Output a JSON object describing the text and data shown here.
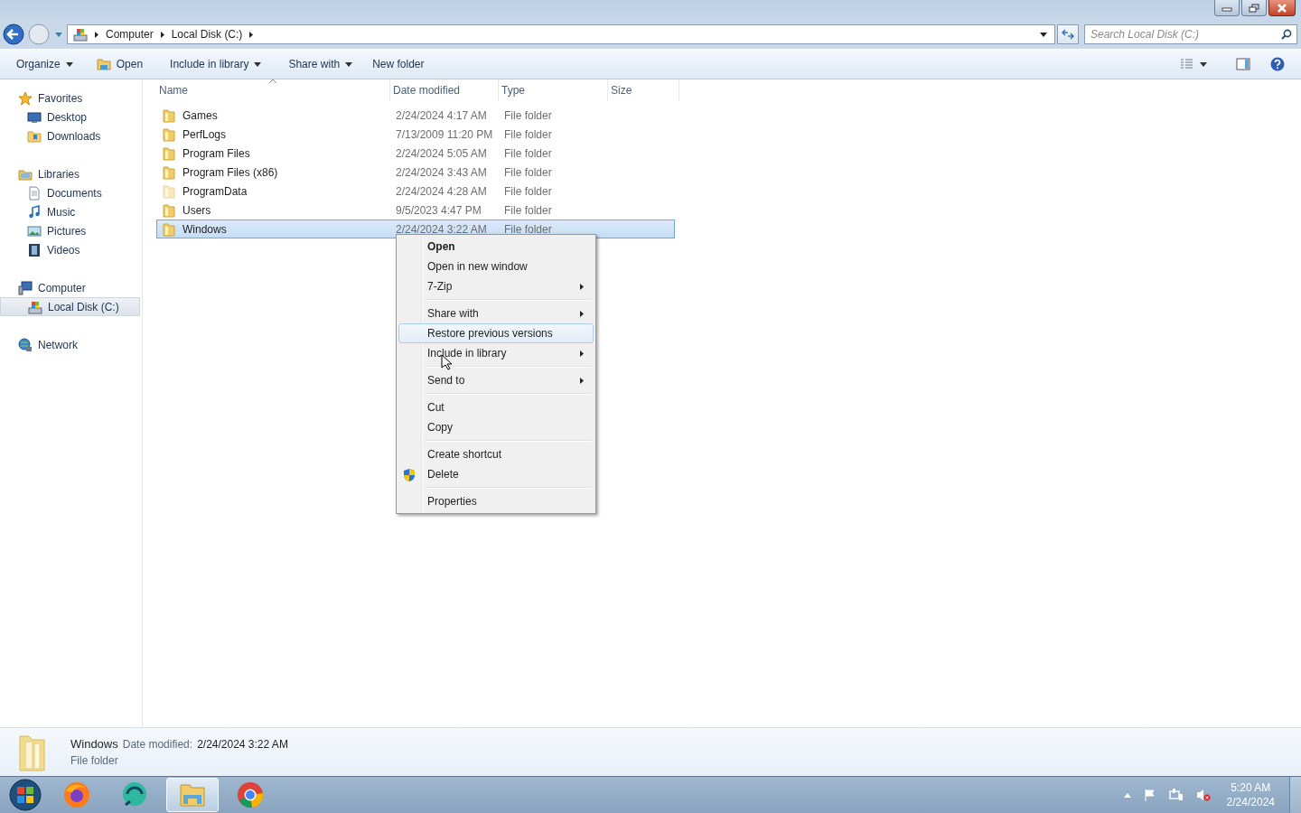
{
  "address_bar": {
    "crumbs": [
      "Computer",
      "Local Disk (C:)"
    ]
  },
  "search": {
    "placeholder": "Search Local Disk (C:)"
  },
  "toolbar": [
    {
      "label": "Organize",
      "kind": "menu"
    },
    {
      "label": "Open",
      "kind": "open"
    },
    {
      "label": "Include in library",
      "kind": "menu"
    },
    {
      "label": "Share with",
      "kind": "menu"
    },
    {
      "label": "New folder",
      "kind": "plain"
    }
  ],
  "sidebar": [
    {
      "label": "Favorites",
      "kind": "star",
      "selected": false,
      "children": [
        {
          "label": "Desktop",
          "kind": "desktop",
          "selected": false
        },
        {
          "label": "Downloads",
          "kind": "folder",
          "selected": false
        }
      ]
    },
    {
      "label": "Libraries",
      "kind": "library",
      "selected": false,
      "children": [
        {
          "label": "Documents",
          "kind": "document",
          "selected": false
        },
        {
          "label": "Music",
          "kind": "music",
          "selected": false
        },
        {
          "label": "Pictures",
          "kind": "pictures",
          "selected": false
        },
        {
          "label": "Videos",
          "kind": "videos",
          "selected": false
        }
      ]
    },
    {
      "label": "Computer",
      "kind": "computer",
      "selected": false,
      "children": [
        {
          "label": "Local Disk (C:)",
          "kind": "drive",
          "selected": true
        }
      ]
    },
    {
      "label": "Network",
      "kind": "network",
      "selected": false
    }
  ],
  "table": {
    "columns": [
      {
        "label": "Name",
        "sorted": true
      },
      {
        "label": "Date modified",
        "sorted": false
      },
      {
        "label": "Type",
        "sorted": false
      },
      {
        "label": "Size",
        "sorted": false
      }
    ],
    "rows": [
      {
        "name": "Games",
        "date": "2/24/2024 4:17 AM",
        "type": "File folder",
        "selected": false,
        "hidden": false
      },
      {
        "name": "PerfLogs",
        "date": "7/13/2009 11:20 PM",
        "type": "File folder",
        "selected": false,
        "hidden": false
      },
      {
        "name": "Program Files",
        "date": "2/24/2024 5:05 AM",
        "type": "File folder",
        "selected": false,
        "hidden": false
      },
      {
        "name": "Program Files (x86)",
        "date": "2/24/2024 3:43 AM",
        "type": "File folder",
        "selected": false,
        "hidden": false
      },
      {
        "name": "ProgramData",
        "date": "2/24/2024 4:28 AM",
        "type": "File folder",
        "selected": false,
        "hidden": true
      },
      {
        "name": "Users",
        "date": "9/5/2023 4:47 PM",
        "type": "File folder",
        "selected": false,
        "hidden": false
      },
      {
        "name": "Windows",
        "date": "2/24/2024 3:22 AM",
        "type": "File folder",
        "selected": true,
        "hidden": false
      }
    ]
  },
  "context_menu": [
    {
      "kind": "item",
      "label": "Open",
      "bold": true,
      "submenu": false,
      "selected": false
    },
    {
      "kind": "item",
      "label": "Open in new window",
      "bold": false,
      "submenu": false,
      "selected": false
    },
    {
      "kind": "item",
      "label": "7-Zip",
      "bold": false,
      "submenu": true,
      "selected": false
    },
    {
      "kind": "separator"
    },
    {
      "kind": "item",
      "label": "Share with",
      "bold": false,
      "submenu": true,
      "selected": false
    },
    {
      "kind": "item",
      "label": "Restore previous versions",
      "bold": false,
      "submenu": false,
      "selected": true
    },
    {
      "kind": "item",
      "label": "Include in library",
      "bold": false,
      "submenu": true,
      "selected": false
    },
    {
      "kind": "separator"
    },
    {
      "kind": "item",
      "label": "Send to",
      "bold": false,
      "submenu": true,
      "selected": false
    },
    {
      "kind": "separator"
    },
    {
      "kind": "item",
      "label": "Cut",
      "bold": false,
      "submenu": false,
      "selected": false
    },
    {
      "kind": "item",
      "label": "Copy",
      "bold": false,
      "submenu": false,
      "selected": false
    },
    {
      "kind": "separator"
    },
    {
      "kind": "item",
      "label": "Create shortcut",
      "bold": false,
      "submenu": false,
      "selected": false
    },
    {
      "kind": "shield",
      "label": "Delete",
      "bold": false,
      "submenu": false,
      "selected": false
    },
    {
      "kind": "separator"
    },
    {
      "kind": "item",
      "label": "Properties",
      "bold": false,
      "submenu": false,
      "selected": false
    }
  ],
  "details_pane": {
    "name": "Windows",
    "date_label": "Date modified:",
    "date": "2/24/2024 3:22 AM",
    "type": "File folder"
  },
  "taskbar": {
    "apps": [
      {
        "kind": "firefox",
        "selected": false
      },
      {
        "kind": "chat",
        "selected": false
      },
      {
        "kind": "explorer",
        "selected": true
      },
      {
        "kind": "chrome",
        "selected": false
      }
    ],
    "tray": {
      "time": "5:20 AM",
      "date": "2/24/2024"
    }
  }
}
